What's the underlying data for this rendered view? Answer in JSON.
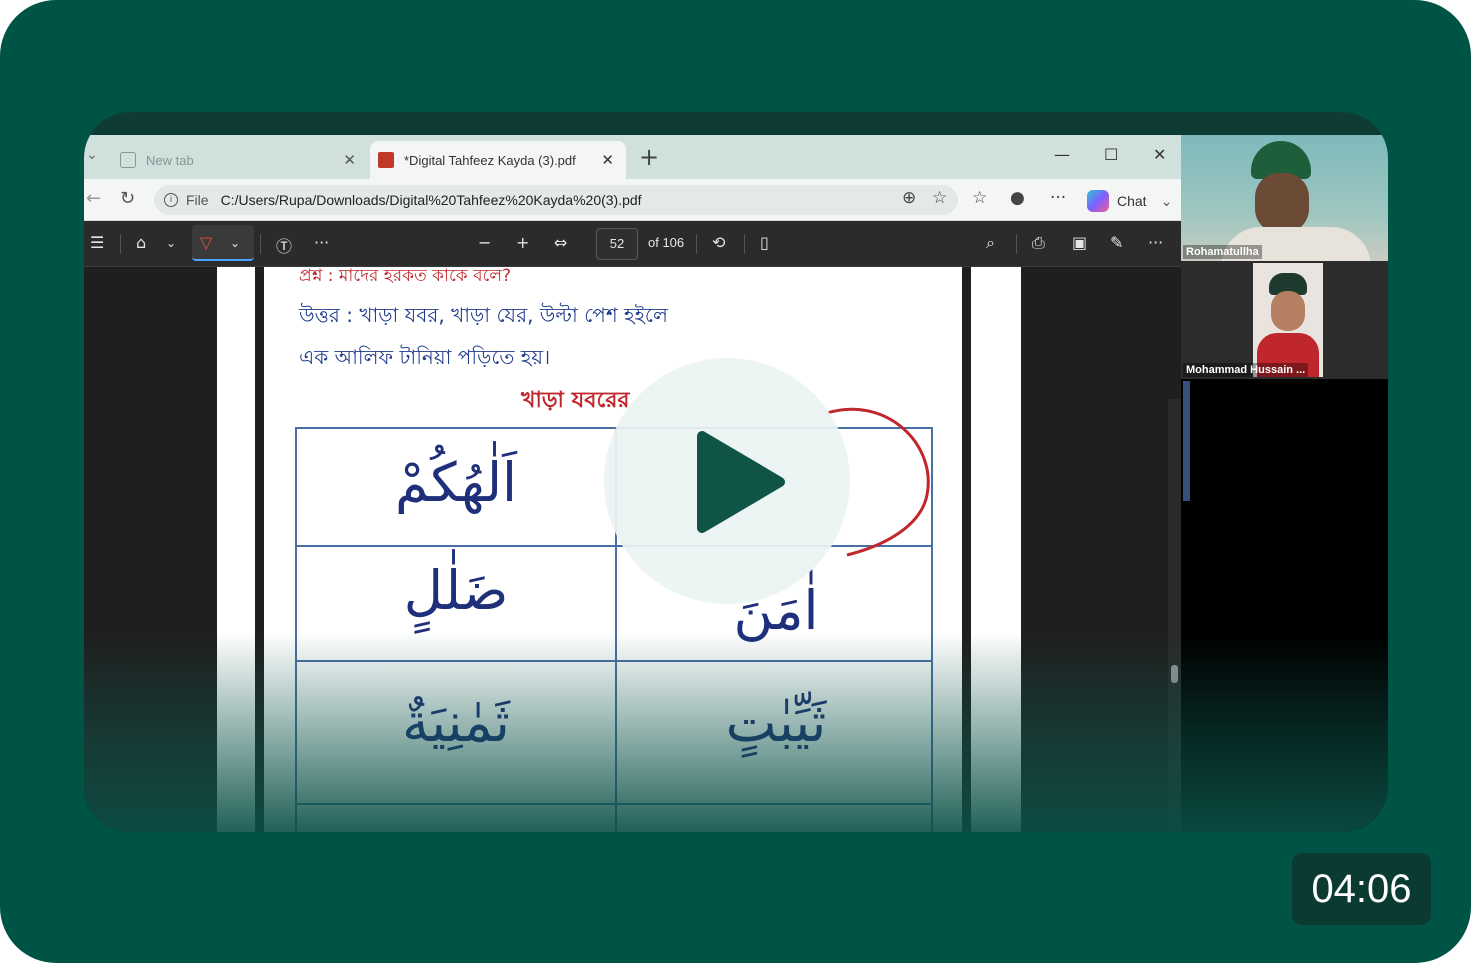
{
  "browser": {
    "tabs": [
      {
        "label": "New tab",
        "active": false
      },
      {
        "label": "*Digital Tahfeez Kayda (3).pdf",
        "active": true
      }
    ],
    "address": {
      "scheme_label": "File",
      "url": "C:/Users/Rupa/Downloads/Digital%20Tahfeez%20Kayda%20(3).pdf"
    },
    "copilot_label": "Chat"
  },
  "pdf_toolbar": {
    "current_page": "52",
    "page_total_label": "of 106"
  },
  "document": {
    "question": "প্রশ্ন : মাদের হরকত কাকে বলে?",
    "answer_line1": "উত্তর : খাড়া যবর, খাড়া যের, উল্টা পেশ হইলে",
    "answer_line2": "এক আলিফ টানিয়া পড়িতে হয়।",
    "section_heading": "খাড়া যবরের",
    "cells": [
      {
        "text": "اَلٰهُكُمْ"
      },
      {
        "text": "ضَلٰلٍ"
      },
      {
        "text": "اٰمَنَ"
      },
      {
        "text": "ثَمٰنِيَةٌ"
      },
      {
        "text": "ثَيِّبٰتٍ"
      }
    ]
  },
  "participants": [
    {
      "name": "Rohamatullha"
    },
    {
      "name": "Mohammad Hussain ..."
    }
  ],
  "video": {
    "duration": "04:06"
  },
  "colors": {
    "background": "#005445",
    "annotation_red": "#c0272d",
    "text_blue": "#1f3b8c"
  }
}
